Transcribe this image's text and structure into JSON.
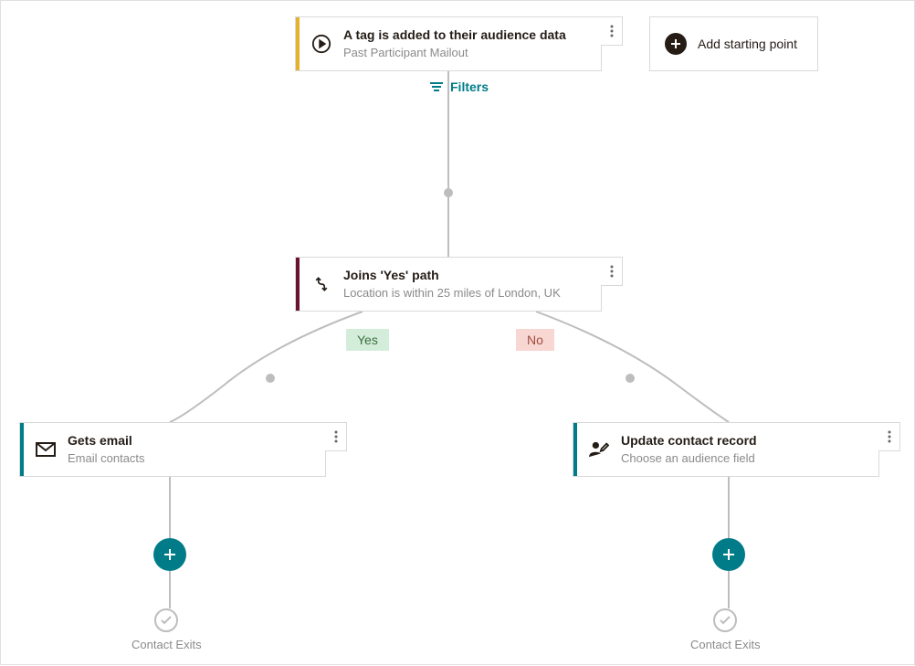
{
  "starting_point": {
    "title": "A tag is added to their audience data",
    "subtitle": "Past Participant Mailout"
  },
  "add_starting": {
    "label": "Add starting point"
  },
  "filters": {
    "label": "Filters"
  },
  "condition": {
    "title": "Joins 'Yes' path",
    "subtitle": "Location is within 25 miles of London, UK"
  },
  "branches": {
    "yes": "Yes",
    "no": "No"
  },
  "email_action": {
    "title": "Gets email",
    "subtitle": "Email contacts"
  },
  "update_action": {
    "title": "Update contact record",
    "subtitle": "Choose an audience field"
  },
  "exits": {
    "left": "Contact Exits",
    "right": "Contact Exits"
  }
}
